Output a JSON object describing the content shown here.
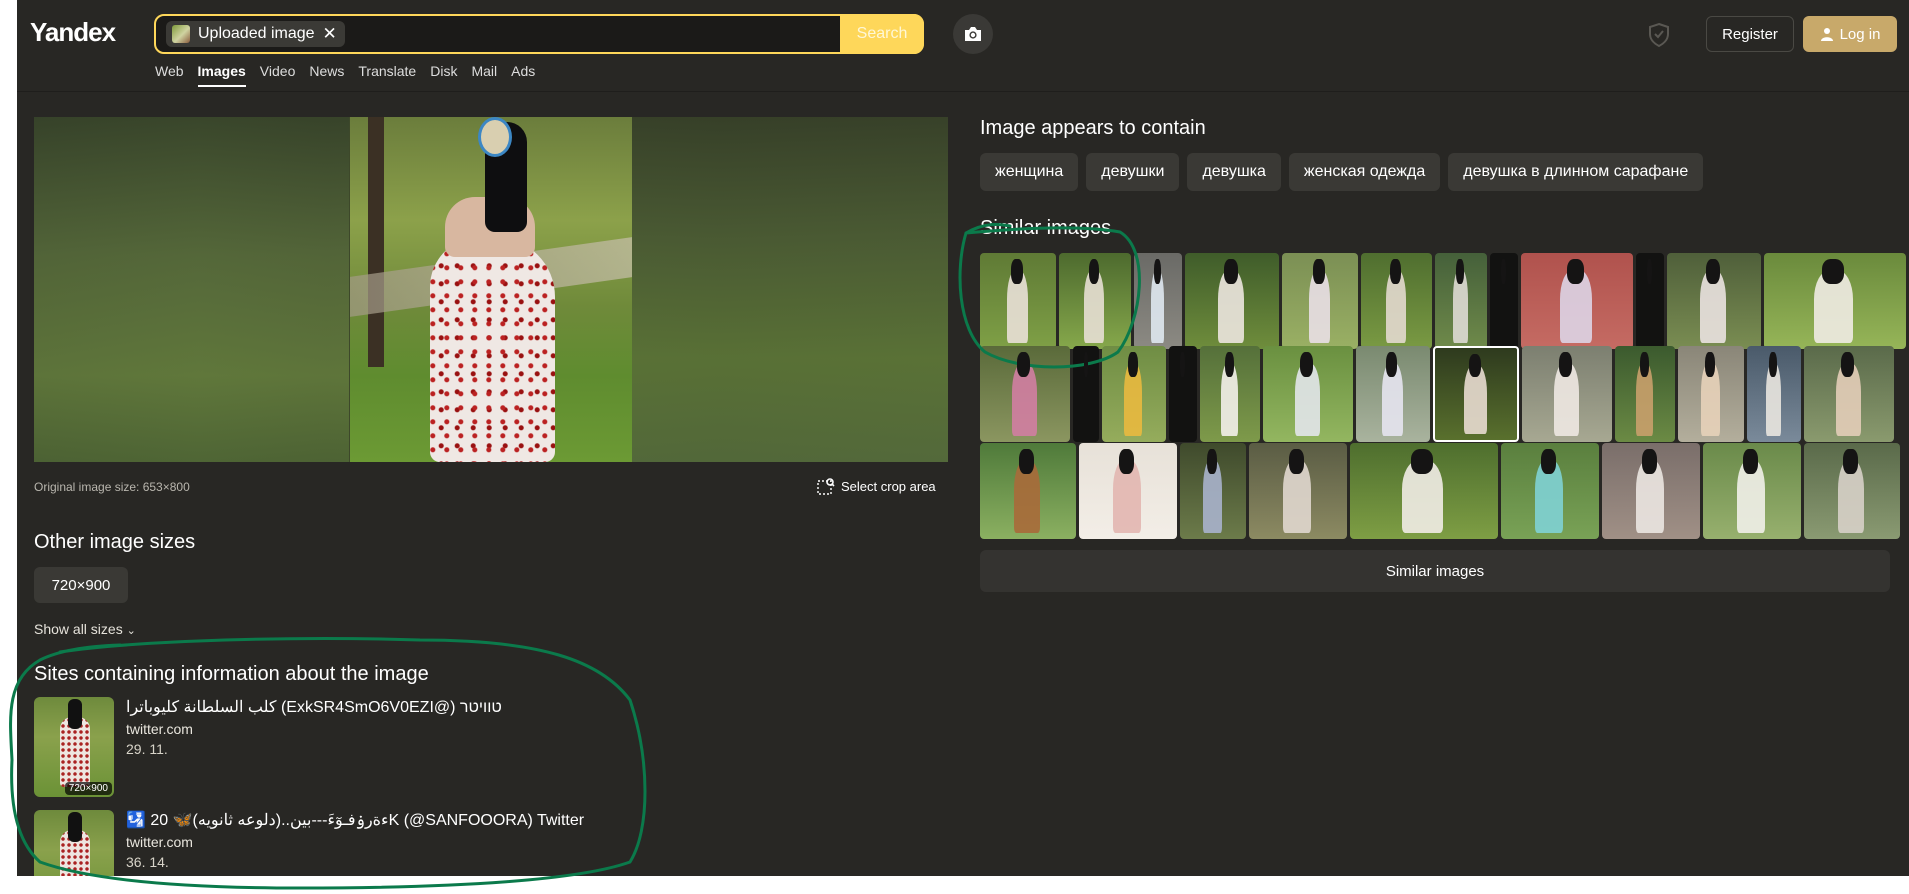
{
  "header": {
    "logo": "Yandex",
    "search": {
      "chip_label": "Uploaded image",
      "chip_close": "✕",
      "button_label": "Search"
    },
    "register_label": "Register",
    "login_label": "Log in"
  },
  "nav": {
    "items": [
      "Web",
      "Images",
      "Video",
      "News",
      "Translate",
      "Disk",
      "Mail",
      "Ads"
    ],
    "active": "Images"
  },
  "left": {
    "original_size": "Original image size: 653×800",
    "crop_label": "Select crop area",
    "other_sizes_title": "Other image sizes",
    "size_chip": "720×900",
    "show_all": "Show all sizes",
    "sites_title": "Sites containing information about the image",
    "sites": [
      {
        "title": "טוויטר (@ExkSR4SmO6V0EZI) كلب السلطانة كليوباترا",
        "host": "twitter.com",
        "date": "29. 11.",
        "badge": "720×900"
      },
      {
        "title": "🛂 20 🦋(دلوعه ثانويه)..ءةرۏفـوٓءَ---بين‌K (@SANFOOORA) Twitter",
        "host": "twitter.com",
        "date": "36. 14.",
        "badge": ""
      }
    ]
  },
  "right": {
    "contains_title": "Image appears to contain",
    "tags": [
      "женщина",
      "девушки",
      "девушка",
      "женская одежда",
      "девушка в длинном сарафане"
    ],
    "similar_title": "Similar images",
    "similar_button": "Similar images"
  },
  "colors": {
    "accent": "#fed75a",
    "login": "#c8a96a",
    "background": "#282724",
    "annotation": "#0b7a4b"
  }
}
